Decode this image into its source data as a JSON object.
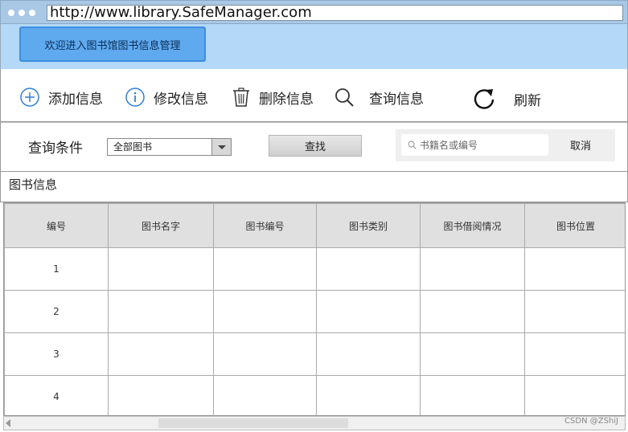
{
  "browser": {
    "url": "http://www.library.SafeManager.com"
  },
  "banner": {
    "welcome": "欢迎进入图书馆图书信息管理"
  },
  "toolbar": {
    "add": "添加信息",
    "edit": "修改信息",
    "delete": "删除信息",
    "query": "查询信息",
    "refresh": "刷新"
  },
  "query": {
    "label": "查询条件",
    "select_value": "全部图书",
    "find_label": "查找",
    "search_placeholder": "书籍名或编号",
    "cancel_label": "取消"
  },
  "section": {
    "title": "图书信息"
  },
  "table": {
    "headers": [
      "编号",
      "图书名字",
      "图书编号",
      "图书类别",
      "图书借阅情况",
      "图书位置"
    ],
    "rows": [
      [
        "1",
        "",
        "",
        "",
        "",
        ""
      ],
      [
        "2",
        "",
        "",
        "",
        "",
        ""
      ],
      [
        "3",
        "",
        "",
        "",
        "",
        ""
      ],
      [
        "4",
        "",
        "",
        "",
        "",
        ""
      ]
    ]
  },
  "watermark": "CSDN @ZShiJ",
  "colors": {
    "banner": "#b4d8f7",
    "welcome_button": "#5fa9ef",
    "icon_blue": "#2f7fd6"
  }
}
